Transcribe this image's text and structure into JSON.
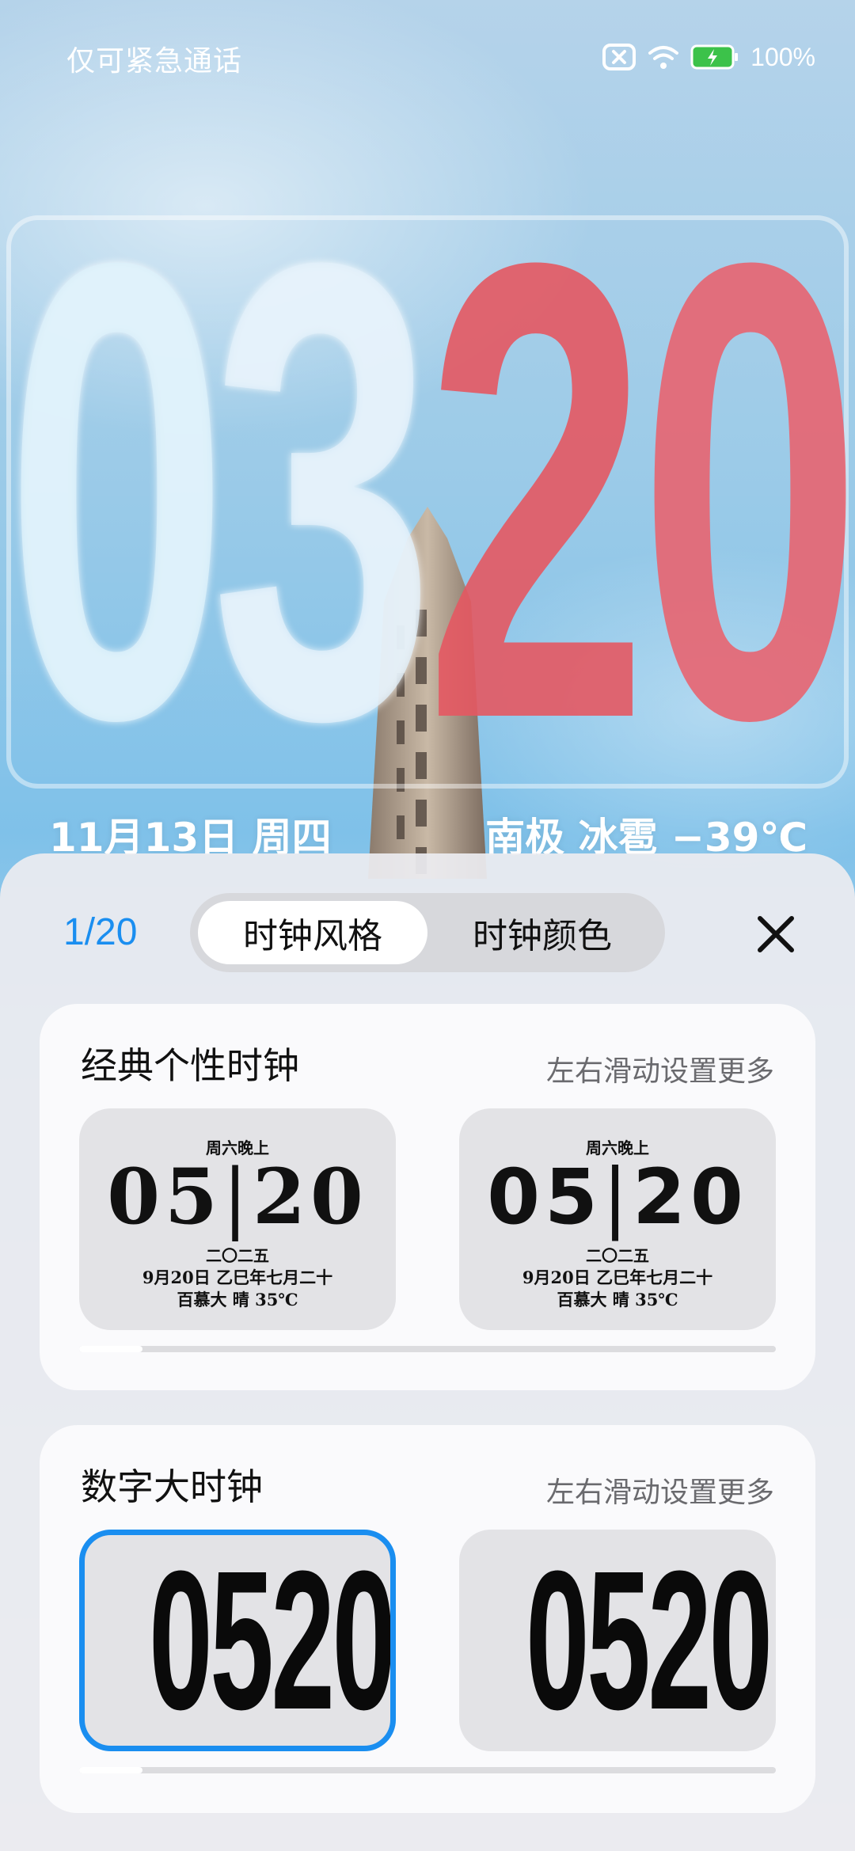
{
  "status_bar": {
    "carrier_text": "仅可紧急通话",
    "battery_pct": "100%",
    "icons": [
      "no-sim-icon",
      "wifi-icon",
      "battery-charging-icon"
    ]
  },
  "lock_clock": {
    "hour_1": "0",
    "hour_2": "3",
    "minute_1": "2",
    "minute_2": "0",
    "date": "11月13日 周四",
    "weather": "南极 冰雹 −39℃",
    "accent_color": "#e4606c"
  },
  "sheet": {
    "page_indicator": "1/20",
    "tabs": [
      {
        "label": "时钟风格",
        "selected": true
      },
      {
        "label": "时钟颜色",
        "selected": false
      }
    ],
    "close_icon": "close-icon"
  },
  "sections": [
    {
      "title": "经典个性时钟",
      "hint": "左右滑动设置更多",
      "tiles": [
        {
          "top": "周六晚上",
          "time_h": "05",
          "time_m": "20",
          "year": "二〇二五",
          "date": "9月20日 乙巳年七月二十",
          "weather": "百慕大 晴 35℃",
          "selected": false
        },
        {
          "top": "周六晚上",
          "time_h": "05",
          "time_m": "20",
          "year": "二〇二五",
          "date": "9月20日 乙巳年七月二十",
          "weather": "百慕大 晴 35℃",
          "selected": false
        }
      ]
    },
    {
      "title": "数字大时钟",
      "hint": "左右滑动设置更多",
      "tiles": [
        {
          "time": "0520",
          "selected": true
        },
        {
          "time": "0520",
          "selected": false
        }
      ]
    }
  ],
  "colors": {
    "accent_blue": "#1a8ef0",
    "sheet_bg": "#ececf0"
  }
}
